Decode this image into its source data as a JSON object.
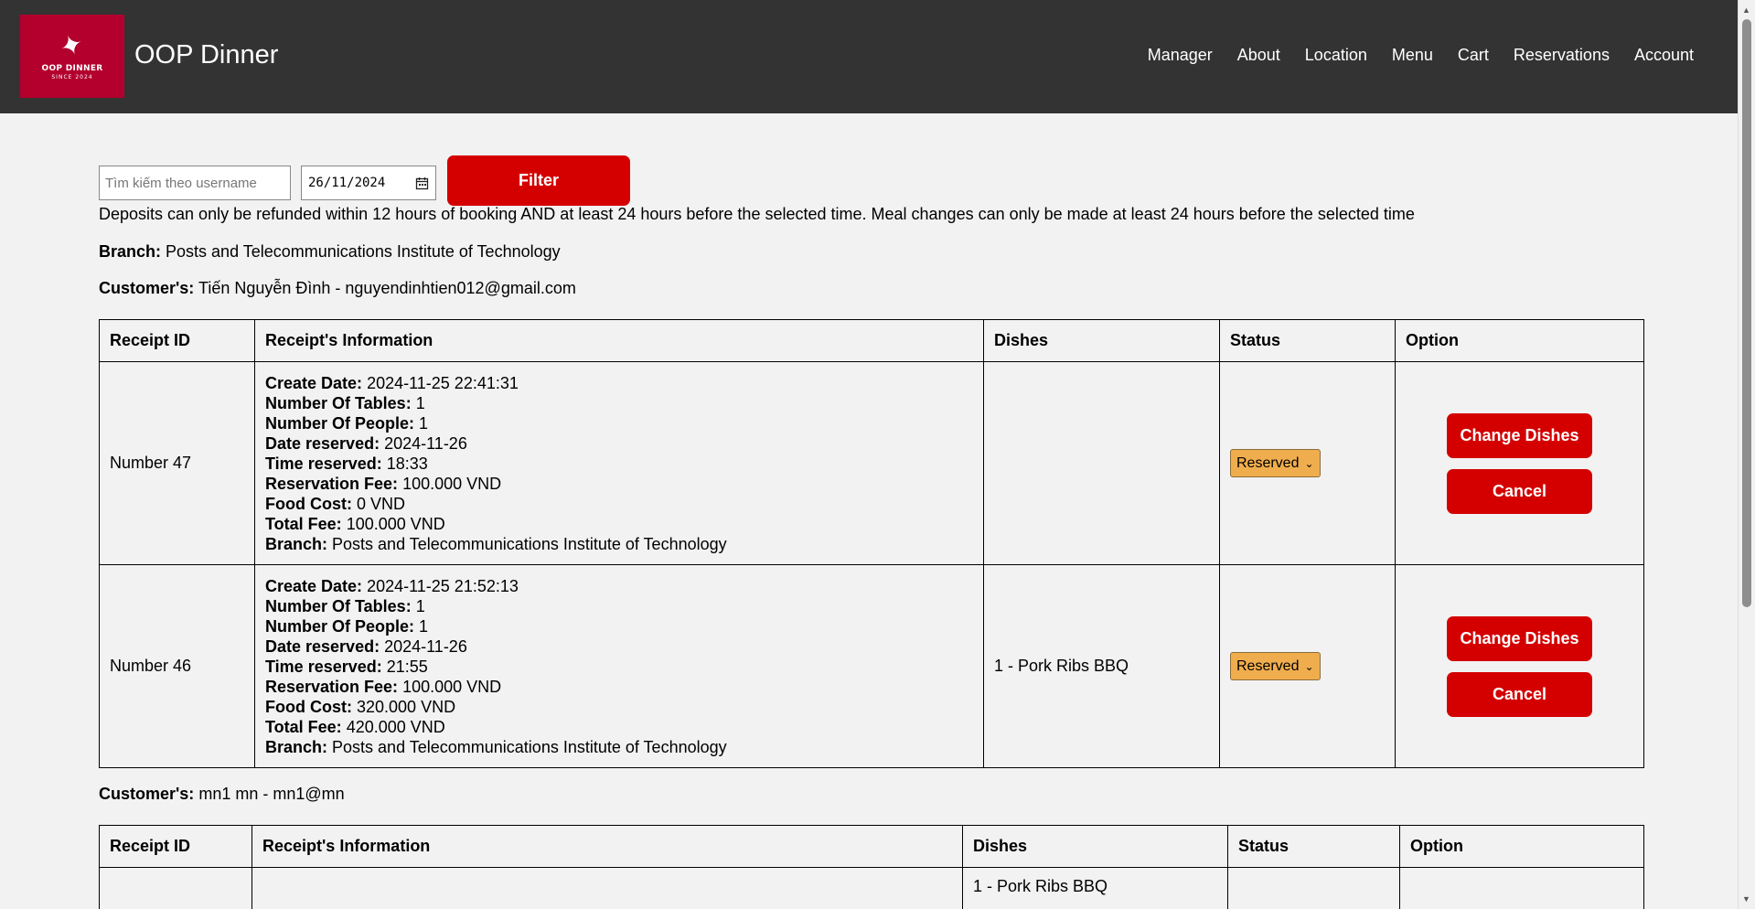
{
  "header": {
    "logo_text": "OOP DINNER",
    "logo_sub": "SINCE 2024",
    "title": "OOP Dinner",
    "nav": [
      "Manager",
      "About",
      "Location",
      "Menu",
      "Cart",
      "Reservations",
      "Account"
    ]
  },
  "filters": {
    "search_placeholder": "Tìm kiếm theo username",
    "date_value": "26/11/2024",
    "filter_label": "Filter"
  },
  "notice": "Deposits can only be refunded within 12 hours of booking AND at least 24 hours before the selected time. Meal changes can only be made at least 24 hours before the selected time",
  "branch": {
    "label": "Branch:",
    "value": "Posts and Telecommunications Institute of Technology"
  },
  "table_headers": [
    "Receipt ID",
    "Receipt's Information",
    "Dishes",
    "Status",
    "Option"
  ],
  "customers": [
    {
      "label": "Customer's:",
      "value": "Tiến Nguyễn Đình - nguyendinhtien012@gmail.com",
      "receipts": [
        {
          "id": "Number 47",
          "info": [
            {
              "k": "Create Date:",
              "v": "2024-11-25 22:41:31"
            },
            {
              "k": "Number Of Tables:",
              "v": "1"
            },
            {
              "k": "Number Of People:",
              "v": "1"
            },
            {
              "k": "Date reserved:",
              "v": "2024-11-26"
            },
            {
              "k": "Time reserved:",
              "v": "18:33"
            },
            {
              "k": "Reservation Fee:",
              "v": "100.000 VND"
            },
            {
              "k": "Food Cost:",
              "v": "0 VND"
            },
            {
              "k": "Total Fee:",
              "v": "100.000 VND"
            },
            {
              "k": "Branch:",
              "v": "Posts and Telecommunications Institute of Technology"
            }
          ],
          "dishes": "",
          "status": "Reserved",
          "change_label": "Change Dishes",
          "cancel_label": "Cancel"
        },
        {
          "id": "Number 46",
          "info": [
            {
              "k": "Create Date:",
              "v": "2024-11-25 21:52:13"
            },
            {
              "k": "Number Of Tables:",
              "v": "1"
            },
            {
              "k": "Number Of People:",
              "v": "1"
            },
            {
              "k": "Date reserved:",
              "v": "2024-11-26"
            },
            {
              "k": "Time reserved:",
              "v": "21:55"
            },
            {
              "k": "Reservation Fee:",
              "v": "100.000 VND"
            },
            {
              "k": "Food Cost:",
              "v": "320.000 VND"
            },
            {
              "k": "Total Fee:",
              "v": "420.000 VND"
            },
            {
              "k": "Branch:",
              "v": "Posts and Telecommunications Institute of Technology"
            }
          ],
          "dishes": "1 - Pork Ribs BBQ",
          "status": "Reserved",
          "change_label": "Change Dishes",
          "cancel_label": "Cancel"
        }
      ]
    },
    {
      "label": "Customer's:",
      "value": "mn1 mn - mn1@mn",
      "partial_dishes": "1 - Pork Ribs BBQ"
    }
  ]
}
